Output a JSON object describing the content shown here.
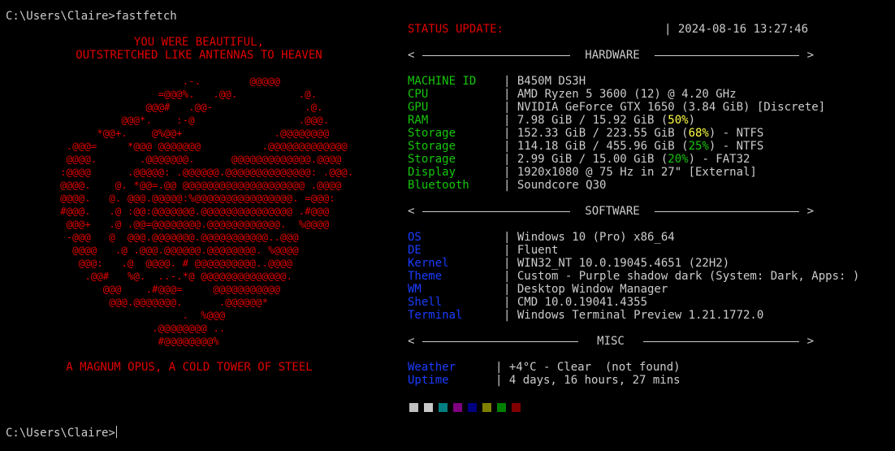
{
  "terminal": {
    "prompt_command": "C:\\Users\\Claire>fastfetch",
    "prompt_idle": "C:\\Users\\Claire>"
  },
  "logo": {
    "quote_top_1": "YOU WERE BEAUTIFUL,",
    "quote_top_2": "OUTSTRETCHED LIKE ANTENNAS TO HEAVEN",
    "ascii": "                        .-.        @@@@@\n                    =@@@%.   .@@.          .@.\n                  @@@#   .@@-               .@.\n              @@@*.    :-@                 .@@@.\n          *@@+.    @%@@+               .@@@@@@@@\n     .@@@=     *@@@ @@@@@@@          .@@@@@@@@@@@@@\n     @@@@.       .@@@@@@@.      @@@@@@@@@@@@@.@@@@\n    :@@@@      .@@@@@: .@@@@@@.@@@@@@@@@@@@@@: .@@@.\n    @@@@.    @. *@@=.@@ @@@@@@@@@@@@@@@@@@@@ .@@@@\n    @@@@.   @. @@@.@@@@@:%@@@@@@@@@@@@@@@@. =@@@:\n    #@@@.   .@ :@@:@@@@@@@.@@@@@@@@@@@@@@@ .#@@@\n     @@@+   .@ .@@=@@@@@@@@.@@@@@@@@@@@@.  %@@@@\n     -@@@   @  @@@.@@@@@@@.@@@@@@@@@@@..@@@\n      @@@@   .@ .@@@.@@@@@@.@@@@@@@@. %@@@@\n       @@@:   .@  @@@@. # @@@@@@@@@@..@@@@\n        .@@#   %@.  ..-.*@ @@@@@@@@@@@@@@.\n           @@@    .#@@@=     @@@@@@@@@@@\n            @@@.@@@@@@@.      .@@@@@@*\n                        .  %@@@\n                   .@@@@@@@@ ..\n                    #@@@@@@@@%",
    "quote_bottom": "A MAGNUM OPUS, A COLD TOWER OF STEEL"
  },
  "status": {
    "label": "STATUS UPDATE:",
    "timestamp": "| 2024-08-16 13:27:46"
  },
  "sections": {
    "lt": "<",
    "gt": ">",
    "hardware": "HARDWARE",
    "software": "SOFTWARE",
    "misc": "MISC"
  },
  "hardware": [
    {
      "key": "MACHINE ID",
      "value": "| B450M DS3H"
    },
    {
      "key": "CPU",
      "value": "| AMD Ryzen 5 3600 (12) @ 4.20 GHz"
    },
    {
      "key": "GPU",
      "value": "| NVIDIA GeForce GTX 1650 (3.84 GiB) [Discrete]"
    },
    {
      "key": "RAM",
      "pre": "| 7.98 GiB / 15.92 GiB (",
      "hl": "50%",
      "post": ")",
      "hl_color": "#ffff44"
    },
    {
      "key": "Storage",
      "pre": "| 152.33 GiB / 223.55 GiB (",
      "hl": "68%",
      "post": ") - NTFS",
      "hl_color": "#ffff44"
    },
    {
      "key": "Storage",
      "pre": "| 114.18 GiB / 455.96 GiB (",
      "hl": "25%",
      "post": ") - NTFS",
      "hl_color": "#16c60c"
    },
    {
      "key": "Storage",
      "pre": "| 2.99 GiB / 15.00 GiB (",
      "hl": "20%",
      "post": ") - FAT32",
      "hl_color": "#16c60c"
    },
    {
      "key": "Display",
      "value": "| 1920x1080 @ 75 Hz in 27\" [External]"
    },
    {
      "key": "Bluetooth",
      "value": "| Soundcore Q30"
    }
  ],
  "software": [
    {
      "key": "OS",
      "value": "| Windows 10 (Pro) x86_64"
    },
    {
      "key": "DE",
      "value": "| Fluent"
    },
    {
      "key": "Kernel",
      "value": "| WIN32_NT 10.0.19045.4651 (22H2)"
    },
    {
      "key": "Theme",
      "value": "| Custom - Purple shadow dark (System: Dark, Apps: )"
    },
    {
      "key": "WM",
      "value": "| Desktop Window Manager"
    },
    {
      "key": "Shell",
      "value": "| CMD 10.0.19041.4355"
    },
    {
      "key": "Terminal",
      "value": "| Windows Terminal Preview 1.21.1772.0"
    }
  ],
  "misc": [
    {
      "key": "Weather",
      "value": "| +4°C - Clear  (not found)"
    },
    {
      "key": "Uptime",
      "value": "| 4 days, 16 hours, 27 mins"
    }
  ],
  "colors": {
    "accent_red": "#e00000",
    "hardware_key": "#16c60c",
    "software_key": "#1a3cff",
    "palette": [
      "#c0c0c0",
      "#c8c8c8",
      "#008080",
      "#800080",
      "#000080",
      "#808000",
      "#008000",
      "#800000"
    ]
  }
}
